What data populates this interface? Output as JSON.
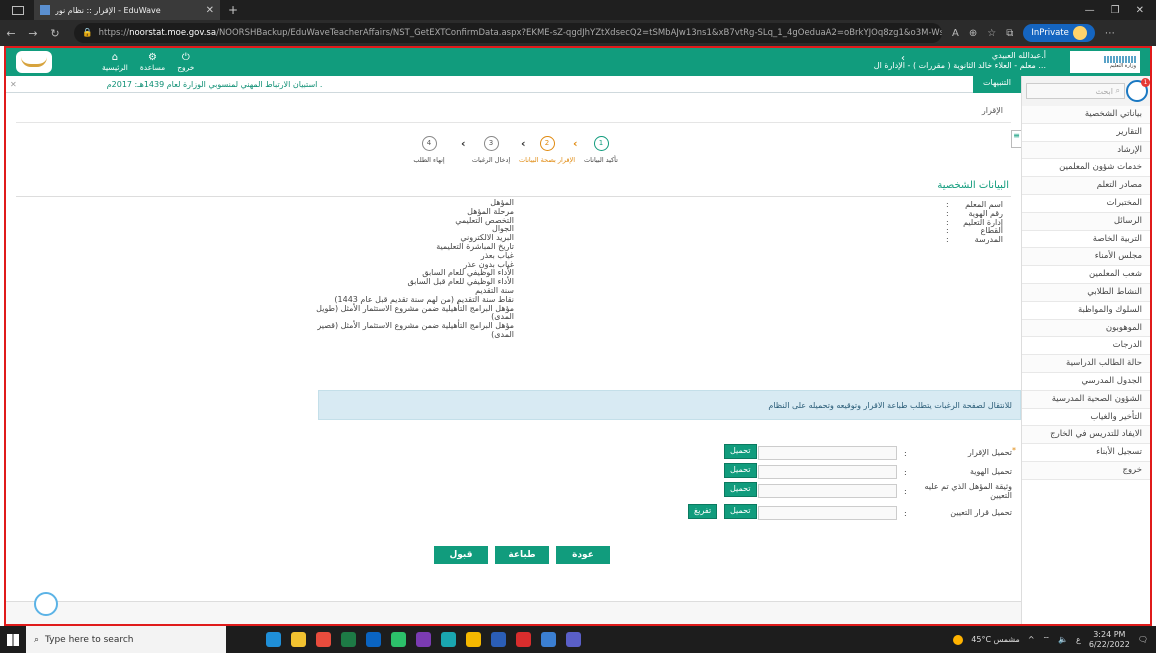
{
  "browser": {
    "tab_title": "الإقرار :: نظام نور - EduWave",
    "url_prefix": "https://",
    "url_host": "noorstat.moe.gov.sa",
    "url_path": "/NOORSHBackup/EduWaveTeacherAffairs/NST_GetEXTConfirmData.aspx?EKME-sZ-qgdJhYZtXdsecQ2=tSMbAJw13ns1&xB7vtRg-SLq_1_4gOeduaA2=oBrkYJOq8zg1&o3M-Ws?SZk81=irv...",
    "inprivate_label": "InPrivate"
  },
  "header": {
    "nav": [
      {
        "label": "الرئيسية",
        "icon": "home-icon"
      },
      {
        "label": "مساعدة",
        "icon": "gear-icon"
      },
      {
        "label": "خروج",
        "icon": "power-icon"
      }
    ],
    "user_name": "أ.عبدالله العبيدي",
    "user_role": "معلم - العلاء خالد الثانوية ( مقررات ) - الإدارة ال ..."
  },
  "notification": {
    "label": "التنبيهات",
    "message": "استبيان الارتباط المهني لمنسوبي الوزارة لعام 1439هـ: 2017م ."
  },
  "sidebar": {
    "search_placeholder": "ابحث",
    "badge": "1",
    "items": [
      "بياناتي الشخصية",
      "التقارير",
      "الإرشاد",
      "خدمات شؤون المعلمين",
      "مصادر التعلم",
      "المختبرات",
      "الرسائل",
      "التربية الخاصة",
      "مجلس الأمناء",
      "شعب المعلمين",
      "النشاط الطلابي",
      "السلوك والمواظبة",
      "الموهوبون",
      "الدرجات",
      "حالة الطالب الدراسية",
      "الجدول المدرسي",
      "الشؤون الصحية المدرسية",
      "التأخير والغياب",
      "الايفاد للتدريس في الخارج",
      "تسجيل الأبناء",
      "خروج"
    ]
  },
  "breadcrumb": "الإقرار",
  "steps": [
    {
      "num": "1",
      "label": "تأكيد البيانات",
      "state": "done"
    },
    {
      "num": "2",
      "label": "الإقرار بصحة البيانات",
      "state": "active"
    },
    {
      "num": "3",
      "label": "إدخال الرغبات",
      "state": "pending"
    },
    {
      "num": "4",
      "label": "إنهاء الطلب",
      "state": "pending"
    }
  ],
  "personal": {
    "title": "البيانات الشخصية",
    "right_fields": [
      "اسم المعلم",
      "رقم الهوية",
      "إدارة التعليم",
      "القطاع",
      "المدرسة"
    ],
    "colon": ":",
    "left_fields": [
      "المؤهل",
      "مرحلة المؤهل",
      "التخصص التعليمي",
      "الجوال",
      "البريد الالكتروني",
      "تاريخ المباشرة التعليمية",
      "غياب بعذر",
      "غياب بدون عذر",
      "الأداء الوظيفي للعام السابق",
      "الأداء الوظيفي للعام قبل السابق",
      "سنة التقديم",
      "نقاط سنة التقديم (من لهم سنة تقديم قبل عام 1443)",
      "مؤهل البرامج التأهيلية ضمن مشروع الاستثمار الأمثل (طويل المدى)",
      "مؤهل البرامج التأهيلية ضمن مشروع الاستثمار الأمثل (قصير المدى)"
    ]
  },
  "alert_text": "للانتقال لصفحة الرغبات يتطلب طباعة الاقرار وتوقيعه وتحميله على النظام",
  "uploads": {
    "required_mark": "*",
    "upload_label": "تحميل",
    "clear_label": "تفريغ",
    "rows": [
      {
        "label": "تحميل الإقرار"
      },
      {
        "label": "تحميل الهوية"
      },
      {
        "label": "وثيقة المؤهل الذي تم عليه التعيين"
      },
      {
        "label": "تحميل قرار التعيين"
      }
    ]
  },
  "actions": {
    "back": "عودة",
    "print": "طباعة",
    "accept": "قبول"
  },
  "taskbar": {
    "search_placeholder": "Type here to search",
    "weather": "45°C مشمس",
    "time": "3:24 PM",
    "date": "6/22/2022",
    "lang": "ع"
  },
  "colors": {
    "primary": "#119c7d",
    "accent": "#e08a10",
    "frame": "#e01b1b"
  }
}
